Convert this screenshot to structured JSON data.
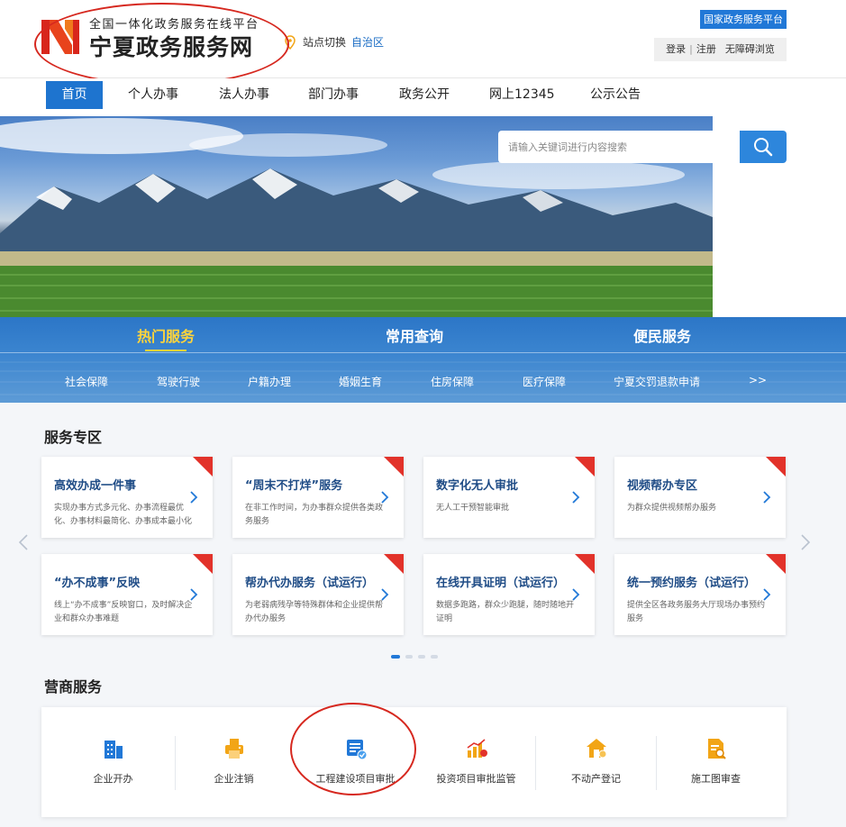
{
  "header": {
    "logo_subtitle": "全国一体化政务服务在线平台",
    "logo_title": "宁夏政务服务网",
    "site_switch_label": "站点切换",
    "site_region": "自治区",
    "national_platform": "国家政务服务平台",
    "login": "登录",
    "register": "注册",
    "accessibility": "无障碍浏览"
  },
  "nav": {
    "items": [
      "首页",
      "个人办事",
      "法人办事",
      "部门办事",
      "政务公开",
      "网上12345",
      "公示公告"
    ]
  },
  "search": {
    "placeholder": "请输入关键词进行内容搜索"
  },
  "service_tabs": {
    "tabs": [
      "热门服务",
      "常用查询",
      "便民服务"
    ],
    "items": [
      "社会保障",
      "驾驶行驶",
      "户籍办理",
      "婚姻生育",
      "住房保障",
      "医疗保障",
      "宁夏交罚退款申请",
      ">>"
    ]
  },
  "service_zone": {
    "title": "服务专区",
    "cards": [
      {
        "title": "高效办成一件事",
        "desc": "实现办事方式多元化、办事流程最优化、办事材料最简化、办事成本最小化"
      },
      {
        "title": "“周末不打烊”服务",
        "desc": "在非工作时间，为办事群众提供各类政务服务"
      },
      {
        "title": "数字化无人审批",
        "desc": "无人工干预智能审批"
      },
      {
        "title": "视频帮办专区",
        "desc": "为群众提供视频帮办服务"
      },
      {
        "title": "“办不成事”反映",
        "desc": "线上“办不成事”反映窗口，及时解决企业和群众办事难题"
      },
      {
        "title": "帮办代办服务（试运行）",
        "desc": "为老弱病残孕等特殊群体和企业提供帮办代办服务"
      },
      {
        "title": "在线开具证明（试运行）",
        "desc": "数据多跑路，群众少跑腿，随时随地开证明"
      },
      {
        "title": "统一预约服务（试运行）",
        "desc": "提供全区各政务服务大厅现场办事预约服务"
      }
    ]
  },
  "business": {
    "title": "营商服务",
    "items": [
      "企业开办",
      "企业注销",
      "工程建设项目审批",
      "投资项目审批监管",
      "不动产登记",
      "施工图审查"
    ]
  },
  "colors": {
    "primary_blue": "#1e74cf",
    "highlight_yellow": "#ffd43b",
    "annotation_red": "#d6281f",
    "card_title_blue": "#1f4c86",
    "biz_icon_blue": "#2178d7",
    "biz_icon_orange": "#f2a516"
  },
  "icons": {
    "logo": "ningxia-n-logo",
    "site_switch": "map-pin-icon",
    "search": "search-icon",
    "card_more": "chevron-right-icon",
    "new_badge": "new-corner-badge",
    "carousel_prev": "chevron-left-icon",
    "carousel_next": "chevron-right-icon",
    "business": [
      "enterprise-building-icon",
      "printer-icon",
      "project-approval-icon",
      "investment-chart-icon",
      "house-icon",
      "document-search-icon"
    ]
  },
  "carousel": {
    "pages": 4,
    "current": 1
  }
}
